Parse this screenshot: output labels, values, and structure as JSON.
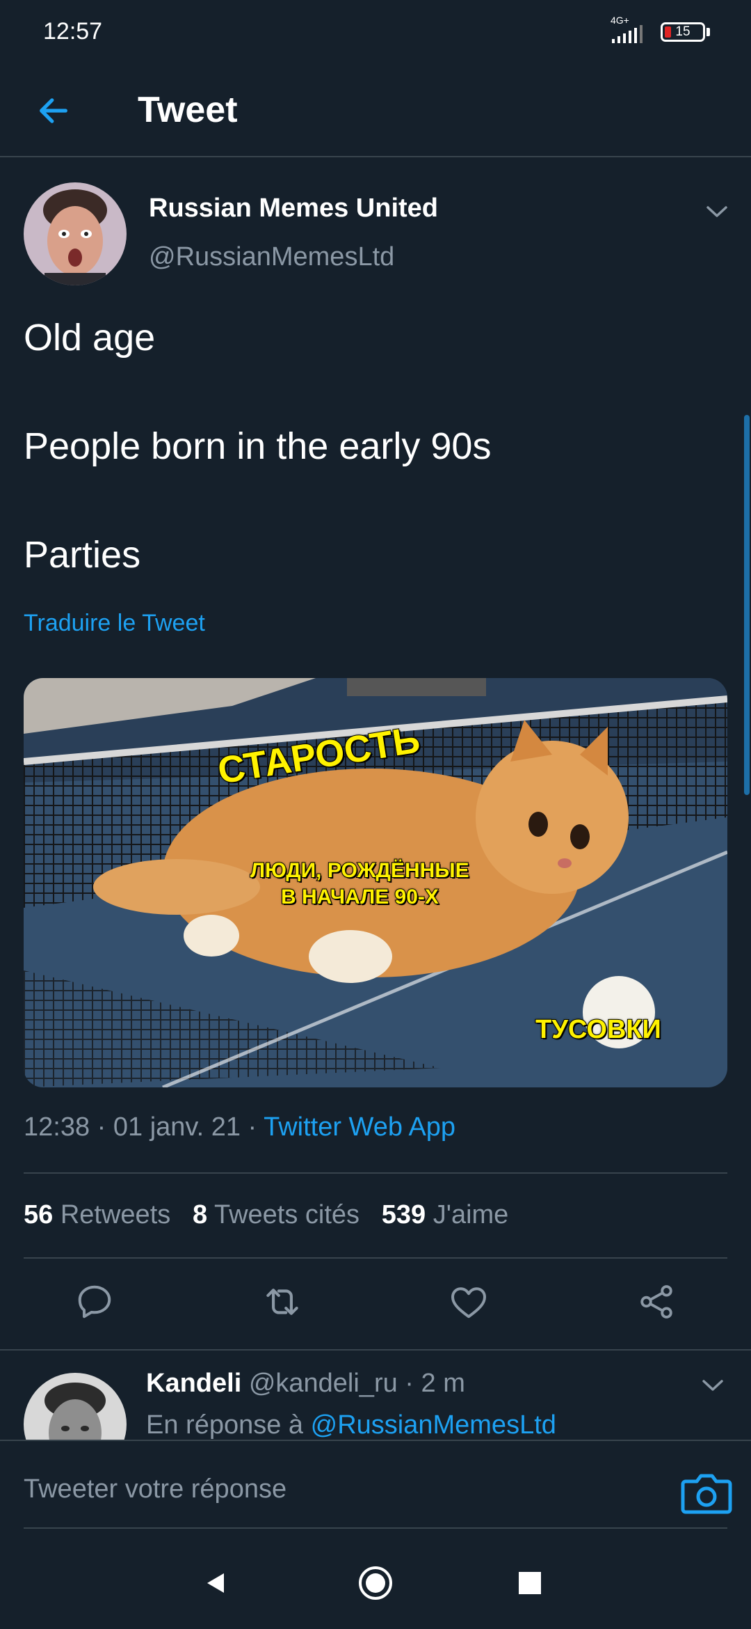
{
  "status_bar": {
    "time": "12:57",
    "network": "4G+",
    "battery": "15"
  },
  "header": {
    "title": "Tweet"
  },
  "tweet": {
    "author_name": "Russian Memes United",
    "author_handle": "@RussianMemesLtd",
    "lines": [
      "Old age",
      "People born in the early 90s",
      "Parties"
    ],
    "translate_label": "Traduire le Tweet",
    "image_captions": {
      "top": "СТАРОСТЬ",
      "middle_line1": "ЛЮДИ, РОЖДЁННЫЕ",
      "middle_line2": "В НАЧАЛЕ 90-Х",
      "bottom": "ТУСОВКИ"
    },
    "time": "12:38",
    "date": "01 janv. 21",
    "source": "Twitter Web App",
    "separator": " · ",
    "stats": {
      "retweets_count": "56",
      "retweets_label": "Retweets",
      "quotes_count": "8",
      "quotes_label": "Tweets cités",
      "likes_count": "539",
      "likes_label": "J'aime"
    }
  },
  "reply": {
    "name": "Kandeli",
    "handle": "@kandeli_ru",
    "time": "2 m",
    "separator": " · ",
    "context_prefix": "En réponse à",
    "context_handle": "@RussianMemesLtd"
  },
  "composer": {
    "placeholder": "Tweeter votre réponse"
  },
  "colors": {
    "background": "#15202b",
    "accent": "#1da1f2",
    "muted": "#8b98a5",
    "divider": "#38444d",
    "caption": "#fff200"
  },
  "icons": [
    "back-arrow-icon",
    "chevron-down-icon",
    "reply-icon",
    "retweet-icon",
    "like-icon",
    "share-icon",
    "camera-icon",
    "nav-back-icon",
    "nav-home-icon",
    "nav-recents-icon"
  ]
}
